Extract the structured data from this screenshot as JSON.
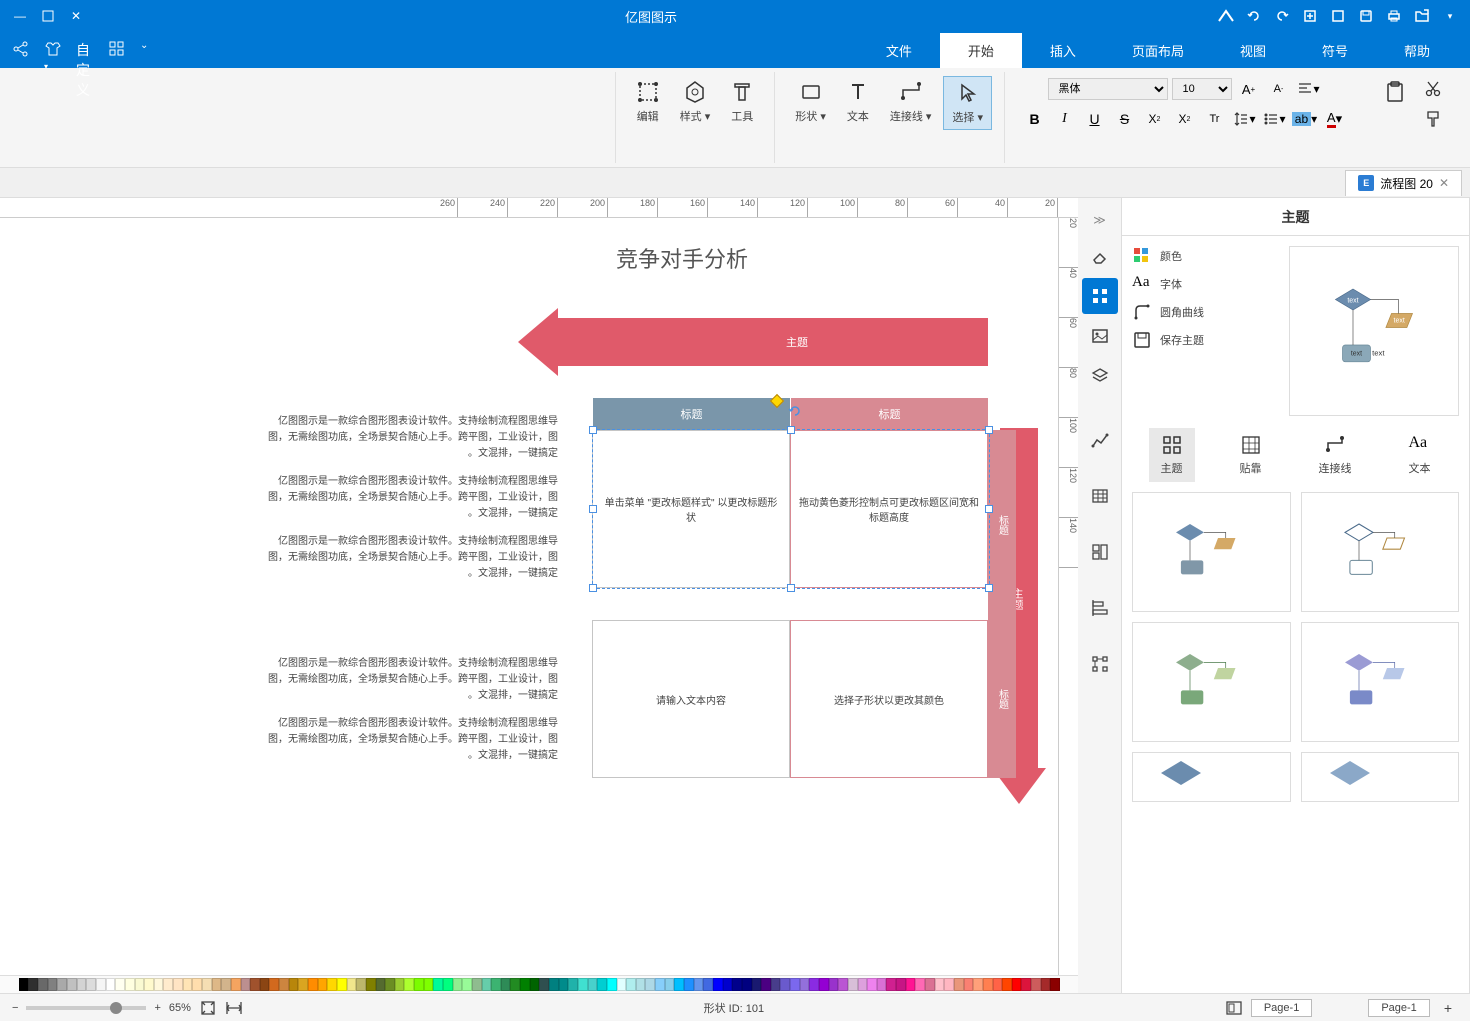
{
  "app": {
    "title": "亿图图示"
  },
  "titlebar_tools": [
    "logo",
    "redo",
    "undo",
    "new-window",
    "save-window",
    "print-window",
    "open",
    "quick1",
    "dropdown"
  ],
  "window_controls": [
    "minimize",
    "maximize",
    "close"
  ],
  "menu": {
    "tabs": [
      "文件",
      "开始",
      "插入",
      "页面布局",
      "视图",
      "符号",
      "帮助"
    ],
    "active": "开始"
  },
  "menubar_tools": [
    "shape-lib",
    "letter-t",
    "tshirt",
    "share",
    "dropdown"
  ],
  "ribbon": {
    "font_name": "黑体",
    "font_size": "10",
    "groups": {
      "clipboard": {
        "paste": "",
        "copy": "",
        "cut": ""
      },
      "text_fmt": [
        "bold",
        "italic",
        "underline",
        "strike",
        "super",
        "sub",
        "case",
        "clear",
        "bullet",
        "number",
        "align",
        "indent",
        "spacing",
        "highlight",
        "fontcolor"
      ],
      "shape": {
        "label": "形状",
        "dd": "▾"
      },
      "text": {
        "label": "文本"
      },
      "connector": {
        "label": "连接线",
        "dd": "▾"
      },
      "select": {
        "label": "选择",
        "dd": "▾"
      },
      "edit_group": {
        "label": "编辑"
      },
      "style": {
        "label": "样式",
        "dd": "▾"
      },
      "tools": {
        "label": "工具"
      }
    }
  },
  "doc_tab": {
    "name": "流程图 20"
  },
  "side_tools": [
    "collapse",
    "eraser",
    "shapes",
    "image",
    "layers",
    "stats",
    "table",
    "layout",
    "align",
    "distribute"
  ],
  "side_active": "shapes",
  "ruler_h": [
    "260",
    "240",
    "220",
    "200",
    "180",
    "160",
    "140",
    "120",
    "100",
    "80",
    "60",
    "40",
    "20"
  ],
  "ruler_v": [
    "20",
    "40",
    "60",
    "80",
    "100",
    "120",
    "140"
  ],
  "canvas": {
    "title": "竞争对手分析",
    "arrow_h_label": "主题",
    "arrow_v_label": "主题",
    "tbl_hdr_1": "标题",
    "tbl_hdr_2": "标题",
    "side_lbl_1": "标题",
    "side_lbl_2": "标题",
    "cell_1_1": "拖动黄色菱形控制点可更改标题区间宽和标题高度",
    "cell_1_2": "单击菜单 \"更改标题样式\" 以更改标题形状",
    "cell_2_1": "选择子形状以更改其颜色",
    "cell_2_2": "请输入文本内容",
    "body1": "亿图图示是一款综合图形图表设计软件。支持绘制流程图思维导图，无需绘图功底，全场景契合随心上手。跨平图，工业设计，图文混排，一键搞定。",
    "body2": "亿图图示是一款综合图形图表设计软件。支持绘制流程图思维导图，无需绘图功底，全场景契合随心上手。跨平图，工业设计，图文混排，一键搞定。",
    "body3": "亿图图示是一款综合图形图表设计软件。支持绘制流程图思维导图，无需绘图功底，全场景契合随心上手。跨平图，工业设计，图文混排，一键搞定。",
    "body4": "亿图图示是一款综合图形图表设计软件。支持绘制流程图思维导图，无需绘图功底，全场景契合随心上手。跨平图，工业设计，图文混排，一键搞定。"
  },
  "theme": {
    "header": "主题",
    "opt_color": "颜色",
    "opt_font": "字体",
    "opt_corner": "圆角曲线",
    "opt_save": "保存主题",
    "tab_theme": "主题",
    "tab_snap": "贴靠",
    "tab_conn": "连接线",
    "tab_text": "文本"
  },
  "palette_colors": [
    "#8b0000",
    "#a52a2a",
    "#cd5c5c",
    "#dc143c",
    "#ff0000",
    "#ff4500",
    "#ff6347",
    "#ff7f50",
    "#ffa07a",
    "#fa8072",
    "#e9967a",
    "#ffb6c1",
    "#ffc0cb",
    "#db7093",
    "#ff69b4",
    "#ff1493",
    "#c71585",
    "#d02090",
    "#da70d6",
    "#ee82ee",
    "#dda0dd",
    "#d8bfd8",
    "#ba55d3",
    "#9932cc",
    "#9400d3",
    "#8a2be2",
    "#9370db",
    "#7b68ee",
    "#6a5acd",
    "#483d8b",
    "#4b0082",
    "#191970",
    "#000080",
    "#00008b",
    "#0000cd",
    "#0000ff",
    "#4169e1",
    "#6495ed",
    "#1e90ff",
    "#00bfff",
    "#87ceeb",
    "#87cefa",
    "#add8e6",
    "#b0e0e6",
    "#afeeee",
    "#e0ffff",
    "#00ffff",
    "#00ced1",
    "#48d1cc",
    "#40e0d0",
    "#20b2aa",
    "#008b8b",
    "#008080",
    "#2f4f4f",
    "#006400",
    "#008000",
    "#228b22",
    "#2e8b57",
    "#3cb371",
    "#66cdaa",
    "#8fbc8f",
    "#98fb98",
    "#90ee90",
    "#00ff7f",
    "#00fa9a",
    "#7fff00",
    "#7cfc00",
    "#adff2f",
    "#9acd32",
    "#6b8e23",
    "#556b2f",
    "#808000",
    "#bdb76b",
    "#f0e68c",
    "#ffff00",
    "#ffd700",
    "#ffa500",
    "#ff8c00",
    "#daa520",
    "#b8860b",
    "#cd853f",
    "#d2691e",
    "#8b4513",
    "#a0522d",
    "#bc8f8f",
    "#f4a460",
    "#d2b48c",
    "#deb887",
    "#f5deb3",
    "#ffdead",
    "#ffe4b5",
    "#ffe4c4",
    "#ffebcd",
    "#fff8dc",
    "#fffacd",
    "#fafad2",
    "#ffffe0",
    "#fffff0",
    "#ffffff",
    "#f5f5f5",
    "#dcdcdc",
    "#d3d3d3",
    "#c0c0c0",
    "#a9a9a9",
    "#808080",
    "#696969",
    "#2f2f2f",
    "#000000"
  ],
  "status": {
    "page_tab_1": "Page-1",
    "page_tab_2": "Page-1",
    "shape_id": "形状 ID: 101",
    "zoom": "65%"
  }
}
